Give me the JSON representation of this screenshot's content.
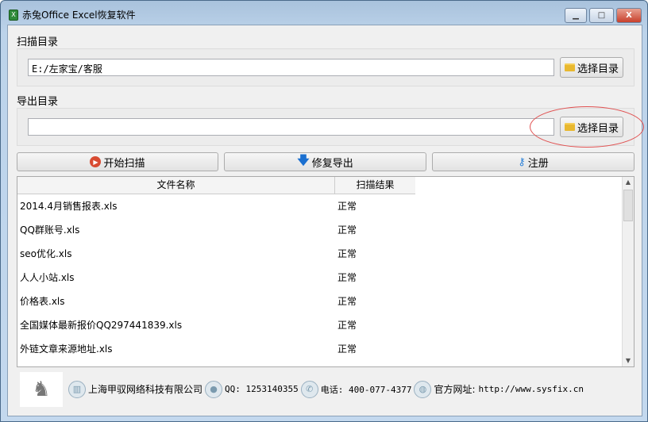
{
  "window": {
    "title": "赤兔Office Excel恢复软件",
    "minimize": "▁",
    "maximize": "□",
    "close": "X"
  },
  "scan": {
    "label": "扫描目录",
    "path": "E:/左家宝/客服",
    "choose_label": "选择目录"
  },
  "export": {
    "label": "导出目录",
    "path": "",
    "choose_label": "选择目录"
  },
  "actions": {
    "start_scan": "开始扫描",
    "repair_export": "修复导出",
    "register": "注册"
  },
  "table": {
    "headers": [
      "文件名称",
      "扫描结果"
    ],
    "rows": [
      {
        "name": "2014.4月销售报表.xls",
        "result": "正常"
      },
      {
        "name": "QQ群账号.xls",
        "result": "正常"
      },
      {
        "name": "seo优化.xls",
        "result": "正常"
      },
      {
        "name": "人人小站.xls",
        "result": "正常"
      },
      {
        "name": "价格表.xls",
        "result": "正常"
      },
      {
        "name": "全国媒体最新报价QQ297441839.xls",
        "result": "正常"
      },
      {
        "name": "外链文章来源地址.xls",
        "result": "正常"
      }
    ]
  },
  "footer": {
    "company": "上海甲驭网络科技有限公司",
    "qq": "QQ: 1253140355",
    "phone": "电话: 400-077-4377",
    "site_label": "官方网址:",
    "site_url": "http://www.sysfix.cn"
  },
  "colors": {
    "accent_red": "#e04040",
    "title_bar": "#bcd3ea"
  }
}
